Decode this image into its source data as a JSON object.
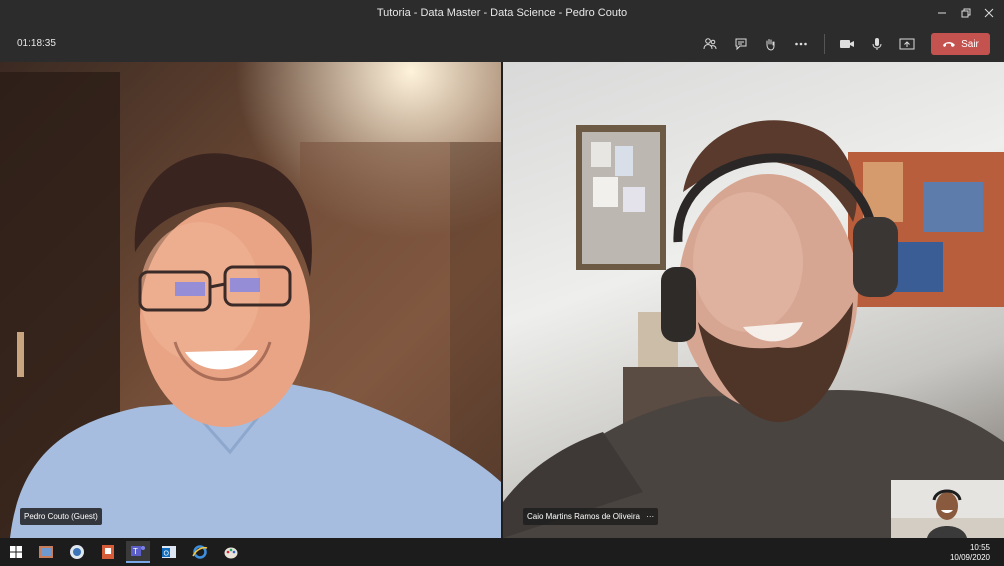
{
  "window": {
    "title": "Tutoria - Data Master - Data Science - Pedro Couto",
    "minimize_icon": "minimize-icon",
    "maximize_icon": "restore-icon",
    "close_icon": "close-icon"
  },
  "toolbar": {
    "timer": "01:18:35",
    "buttons": [
      "participants-icon",
      "chat-icon",
      "raise-hand-icon",
      "more-options-icon",
      "camera-icon",
      "microphone-icon",
      "share-screen-icon"
    ],
    "leave_label": "Sair"
  },
  "participants": [
    {
      "name": "Pedro Couto (Guest)"
    },
    {
      "name": "Caio Martins Ramos de Oliveira",
      "more": "···"
    }
  ],
  "taskbar": {
    "apps": [
      "windows-start",
      "photos-app",
      "skype-app",
      "powerpoint-app",
      "teams-app",
      "outlook-app",
      "internet-explorer-app",
      "paint-app"
    ],
    "time": "10:55",
    "date": "10/09/2020"
  },
  "colors": {
    "leave": "#c4524f",
    "bar": "#2d2c2c",
    "taskbar": "#1c1c1c"
  }
}
